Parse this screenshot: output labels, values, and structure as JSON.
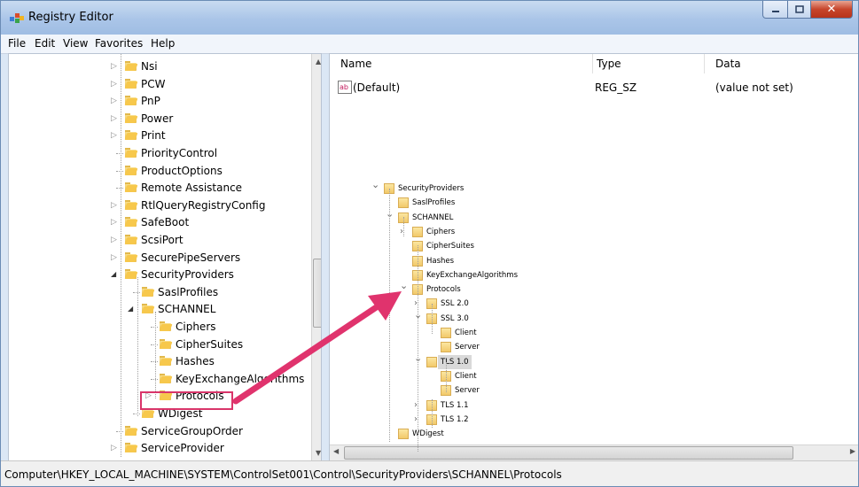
{
  "window": {
    "title": "Registry Editor"
  },
  "menu": [
    "File",
    "Edit",
    "View",
    "Favorites",
    "Help"
  ],
  "tree": [
    {
      "label": "Nsi",
      "expander": "closed",
      "indent": 0
    },
    {
      "label": "PCW",
      "expander": "closed",
      "indent": 0
    },
    {
      "label": "PnP",
      "expander": "closed",
      "indent": 0
    },
    {
      "label": "Power",
      "expander": "closed",
      "indent": 0
    },
    {
      "label": "Print",
      "expander": "closed",
      "indent": 0
    },
    {
      "label": "PriorityControl",
      "expander": "none",
      "indent": 0
    },
    {
      "label": "ProductOptions",
      "expander": "none",
      "indent": 0
    },
    {
      "label": "Remote Assistance",
      "expander": "none",
      "indent": 0
    },
    {
      "label": "RtlQueryRegistryConfig",
      "expander": "closed",
      "indent": 0
    },
    {
      "label": "SafeBoot",
      "expander": "closed",
      "indent": 0
    },
    {
      "label": "ScsiPort",
      "expander": "closed",
      "indent": 0
    },
    {
      "label": "SecurePipeServers",
      "expander": "closed",
      "indent": 0
    },
    {
      "label": "SecurityProviders",
      "expander": "open",
      "indent": 0
    },
    {
      "label": "SaslProfiles",
      "expander": "none",
      "indent": 1
    },
    {
      "label": "SCHANNEL",
      "expander": "open",
      "indent": 1
    },
    {
      "label": "Ciphers",
      "expander": "none",
      "indent": 2
    },
    {
      "label": "CipherSuites",
      "expander": "none",
      "indent": 2
    },
    {
      "label": "Hashes",
      "expander": "none",
      "indent": 2
    },
    {
      "label": "KeyExchangeAlgorithms",
      "expander": "none",
      "indent": 2
    },
    {
      "label": "Protocols",
      "expander": "closed",
      "indent": 2
    },
    {
      "label": "WDigest",
      "expander": "none",
      "indent": 1
    },
    {
      "label": "ServiceGroupOrder",
      "expander": "none",
      "indent": 0
    },
    {
      "label": "ServiceProvider",
      "expander": "closed",
      "indent": 0
    }
  ],
  "list": {
    "columns": [
      "Name",
      "Type",
      "Data"
    ],
    "rows": [
      {
        "name": "(Default)",
        "type": "REG_SZ",
        "data": "(value not set)",
        "icon": "string-value-icon"
      }
    ]
  },
  "inset_tree": [
    {
      "label": "SecurityProviders",
      "expander": "open",
      "indent": 0
    },
    {
      "label": "SaslProfiles",
      "expander": "none",
      "indent": 1
    },
    {
      "label": "SCHANNEL",
      "expander": "open",
      "indent": 1
    },
    {
      "label": "Ciphers",
      "expander": "closed",
      "indent": 2
    },
    {
      "label": "CipherSuites",
      "expander": "none",
      "indent": 2
    },
    {
      "label": "Hashes",
      "expander": "none",
      "indent": 2
    },
    {
      "label": "KeyExchangeAlgorithms",
      "expander": "none",
      "indent": 2
    },
    {
      "label": "Protocols",
      "expander": "open",
      "indent": 2
    },
    {
      "label": "SSL 2.0",
      "expander": "closed",
      "indent": 3
    },
    {
      "label": "SSL 3.0",
      "expander": "open",
      "indent": 3
    },
    {
      "label": "Client",
      "expander": "none",
      "indent": 4
    },
    {
      "label": "Server",
      "expander": "none",
      "indent": 4
    },
    {
      "label": "TLS 1.0",
      "expander": "open",
      "indent": 3,
      "selected": true
    },
    {
      "label": "Client",
      "expander": "none",
      "indent": 4
    },
    {
      "label": "Server",
      "expander": "none",
      "indent": 4
    },
    {
      "label": "TLS 1.1",
      "expander": "closed",
      "indent": 3
    },
    {
      "label": "TLS 1.2",
      "expander": "closed",
      "indent": 3
    },
    {
      "label": "WDigest",
      "expander": "none",
      "indent": 1
    }
  ],
  "status": "Computer\\HKEY_LOCAL_MACHINE\\SYSTEM\\ControlSet001\\Control\\SecurityProviders\\SCHANNEL\\Protocols",
  "colors": {
    "highlight": "#d9356a",
    "arrow": "#e0336d"
  }
}
